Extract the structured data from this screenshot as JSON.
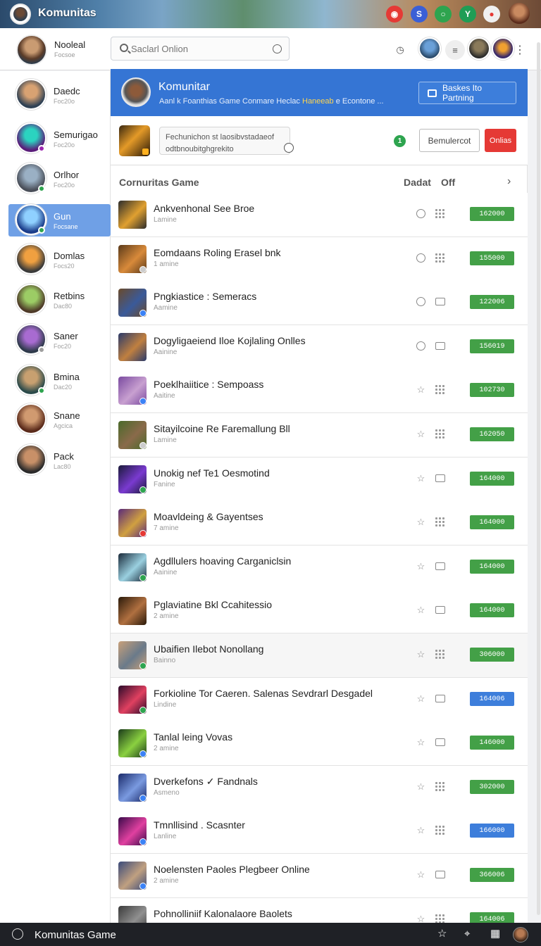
{
  "app": {
    "title": "Komunitas",
    "banner_icons": [
      {
        "name": "chat-bubble-icon",
        "color": "#e53935",
        "glyph": "◉"
      },
      {
        "name": "s-badge-icon",
        "color": "#3b5fd6",
        "glyph": "S"
      },
      {
        "name": "search-bubble-icon",
        "color": "#2ea44f",
        "glyph": "○"
      },
      {
        "name": "y-badge-icon",
        "color": "#1f9d55",
        "glyph": "Y"
      },
      {
        "name": "message-icon",
        "color": "#f0f0f0",
        "glyph": "●"
      }
    ]
  },
  "user": {
    "name": "Nooleal",
    "status": "Focsoe"
  },
  "search": {
    "placeholder": "Saclarl Onlion"
  },
  "sidebar": {
    "contacts": [
      {
        "name": "Daedc",
        "status": "Foc20o",
        "colors": [
          "#d8a272",
          "#2f4154"
        ],
        "dot": ""
      },
      {
        "name": "Semurigao",
        "status": "Foc20o",
        "colors": [
          "#2bd3c0",
          "#5a1d7a"
        ],
        "dot": "#9c27b0"
      },
      {
        "name": "Orlhor",
        "status": "Foc20o",
        "colors": [
          "#9ab0c4",
          "#4a4f59"
        ],
        "dot": "#2ea44f"
      },
      {
        "name": "Gun",
        "status": "Focsane",
        "colors": [
          "#8fd0ff",
          "#1a3c8a"
        ],
        "dot": "#2ea44f",
        "active": true
      },
      {
        "name": "Domlas",
        "status": "Focs20",
        "colors": [
          "#f0a040",
          "#3a3a3a"
        ],
        "dot": ""
      },
      {
        "name": "Retbins",
        "status": "Dac80",
        "colors": [
          "#9ccc65",
          "#4e3a28"
        ],
        "dot": ""
      },
      {
        "name": "Saner",
        "status": "Foc20",
        "colors": [
          "#a86bd1",
          "#2e3a4a"
        ],
        "dot": "#9e9e9e"
      },
      {
        "name": "Bmina",
        "status": "Dac20",
        "colors": [
          "#c8a070",
          "#2b4a4a"
        ],
        "dot": "#2ea44f"
      },
      {
        "name": "Snane",
        "status": "Agcica",
        "colors": [
          "#d09a70",
          "#5a2a1a"
        ],
        "dot": ""
      },
      {
        "name": "Pack",
        "status": "Lac80",
        "colors": [
          "#c89068",
          "#2a2a2a"
        ],
        "dot": ""
      }
    ]
  },
  "hero": {
    "title": "Komunitar",
    "subtitle_prefix": "Aanl k Foanthias Game Conmare Heclac",
    "subtitle_highlight": "Haneeab",
    "subtitle_suffix": "e Econtone ...",
    "button": "Baskes Ito Partning"
  },
  "toolbar": {
    "box_line1": "Fechunichon st laosibvstadaeof",
    "box_line2": "odtbnoubitghgrekito",
    "badge": "1",
    "button": "Bemulercot",
    "red_button": "Onlias"
  },
  "list": {
    "title": "Cornuritas Game",
    "col_a": "Dadat",
    "col_b": "Off",
    "arrow": "›",
    "rows": [
      {
        "name": "Ankvenhonal See Broe",
        "meta": "Lamine",
        "i1": "circle",
        "i2": "grid",
        "score": "162000",
        "score_color": "#43a047",
        "thumb": [
          "#2c2c2c",
          "#e0a030"
        ],
        "badge": ""
      },
      {
        "name": "Eomdaans Roling Erasel bnk",
        "meta": "1 amine",
        "i1": "circle",
        "i2": "grid",
        "score": "155000",
        "score_color": "#43a047",
        "thumb": [
          "#5a3a1a",
          "#d88a3a"
        ],
        "badge": "#cccccc"
      },
      {
        "name": "Pngkiastice : Semeracs",
        "meta": "Aamine",
        "i1": "circle",
        "i2": "box",
        "score": "122006",
        "score_color": "#43a047",
        "thumb": [
          "#6a4a2a",
          "#3a5a9a"
        ],
        "badge": "#3b82f6"
      },
      {
        "name": "Dogyligaeiend Iloe Kojlaling Onlles",
        "meta": "Aainine",
        "i1": "circle",
        "i2": "box",
        "score": "156019",
        "score_color": "#43a047",
        "thumb": [
          "#2a3a6a",
          "#c08040"
        ],
        "badge": ""
      },
      {
        "name": "Poeklhaiitice : Sempoass",
        "meta": "Aaitine",
        "i1": "star",
        "i2": "grid",
        "score": "102730",
        "score_color": "#43a047",
        "thumb": [
          "#7a4aa0",
          "#c8a0d0"
        ],
        "badge": "#3b82f6"
      },
      {
        "name": "Sitayilcoine Re Faremallung Bll",
        "meta": "Lamine",
        "i1": "star",
        "i2": "grid",
        "score": "162050",
        "score_color": "#43a047",
        "thumb": [
          "#4a6a2a",
          "#8a6a4a"
        ],
        "badge": "#cccccc"
      },
      {
        "name": "Unokig nef Te1 Oesmotind",
        "meta": "Fanine",
        "i1": "star",
        "i2": "box",
        "score": "164000",
        "score_color": "#43a047",
        "thumb": [
          "#1a1a3a",
          "#7a3ad0"
        ],
        "badge": "#2ea44f"
      },
      {
        "name": "Moavldeing & Gayentses",
        "meta": "7 amine",
        "i1": "star",
        "i2": "grid",
        "score": "164000",
        "score_color": "#43a047",
        "thumb": [
          "#5a2a7a",
          "#d0a040"
        ],
        "badge": "#e53935"
      },
      {
        "name": "Agdllulers hoaving Carganiclsin",
        "meta": "Aainine",
        "i1": "star",
        "i2": "box",
        "score": "164000",
        "score_color": "#43a047",
        "thumb": [
          "#1a2a3a",
          "#9ad0e0"
        ],
        "badge": "#2ea44f"
      },
      {
        "name": "Pglaviatine Bkl Ccahitessio",
        "meta": "2 amine",
        "i1": "star",
        "i2": "box",
        "score": "164000",
        "score_color": "#43a047",
        "thumb": [
          "#2a1a0a",
          "#b07040"
        ],
        "badge": ""
      },
      {
        "name": "Ubaifien Ilebot Nonollang",
        "meta": "Bainno",
        "i1": "star",
        "i2": "grid",
        "score": "306000",
        "score_color": "#43a047",
        "thumb": [
          "#c8a07a",
          "#6a7a8a"
        ],
        "badge": "#2ea44f"
      },
      {
        "name": "Forkioline Tor Caeren. Salenas Sevdrarl Desgadel",
        "meta": "Lindine",
        "i1": "star",
        "i2": "box",
        "score": "164006",
        "score_color": "#3d7edb",
        "thumb": [
          "#2a0a2a",
          "#e04060"
        ],
        "badge": "#2ea44f"
      },
      {
        "name": "Tanlal leing Vovas",
        "meta": "2 amine",
        "i1": "star",
        "i2": "box",
        "score": "146000",
        "score_color": "#43a047",
        "thumb": [
          "#1a3a1a",
          "#8ad040"
        ],
        "badge": "#3b82f6"
      },
      {
        "name": "Dverkefons ✓ Fandnals",
        "meta": "Asmeno",
        "i1": "star",
        "i2": "grid",
        "score": "302000",
        "score_color": "#43a047",
        "thumb": [
          "#1a2a6a",
          "#7a9ae0"
        ],
        "badge": "#3b82f6"
      },
      {
        "name": "Tmnllisind . Scasnter",
        "meta": "Lanline",
        "i1": "star",
        "i2": "grid",
        "score": "166000",
        "score_color": "#3d7edb",
        "thumb": [
          "#3a0a4a",
          "#e040a0"
        ],
        "badge": "#3b82f6"
      },
      {
        "name": "Noelensten Paoles Plegbeer Online",
        "meta": "2 amine",
        "i1": "star",
        "i2": "box",
        "score": "366006",
        "score_color": "#43a047",
        "thumb": [
          "#3a4a7a",
          "#c0a080"
        ],
        "badge": "#3b82f6"
      },
      {
        "name": "Pohnolliniif Kalonalaore Baolets",
        "meta": "",
        "i1": "star",
        "i2": "grid",
        "score": "164006",
        "score_color": "#43a047",
        "thumb": [
          "#3a3a3a",
          "#909090"
        ],
        "badge": ""
      }
    ]
  },
  "bottom": {
    "title": "Komunitas Game",
    "icons": [
      "star-icon",
      "crosshair-icon",
      "grid-icon"
    ]
  }
}
